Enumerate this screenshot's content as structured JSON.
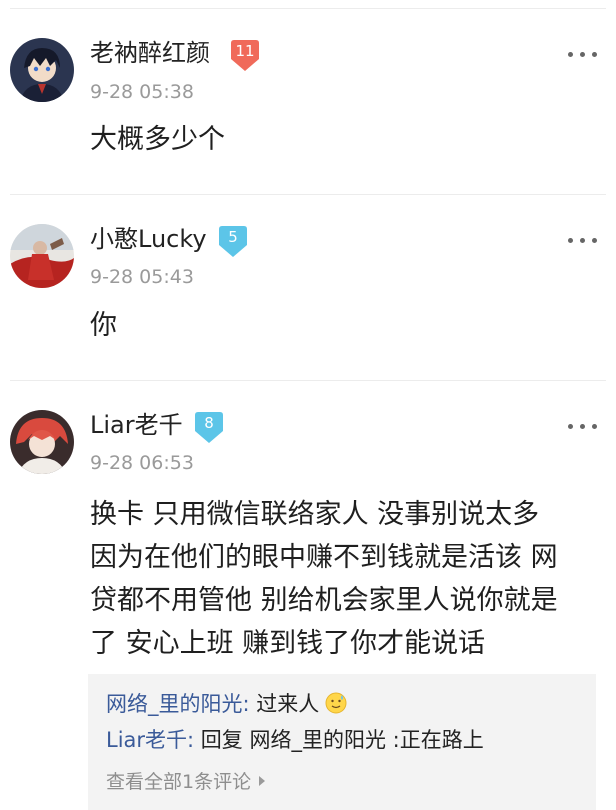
{
  "comments": [
    {
      "username": "老衲醉红颜",
      "level": "11",
      "level_color": "#f06a5a",
      "time": "9-28 05:38",
      "text": "大概多少个",
      "avatar_icon": "anime-boy-avatar"
    },
    {
      "username": "小憨Lucky",
      "level": "5",
      "level_color": "#5cc5e8",
      "time": "9-28 05:43",
      "text": "你",
      "avatar_icon": "person-in-red-avatar"
    },
    {
      "username": "Liar老千",
      "level": "8",
      "level_color": "#5cc5e8",
      "time": "9-28 06:53",
      "text_lines": [
        "换卡 只用微信联络家人 没事别说太多",
        "因为在他们的眼中赚不到钱就是活该 网",
        "贷都不用管他 别给机会家里人说你就是",
        "了 安心上班 赚到钱了你才能说话"
      ],
      "avatar_icon": "anime-red-hair-avatar",
      "replies": [
        {
          "author": "网络_里的阳光",
          "sep": ":",
          "text": " 过来人",
          "emoji": "sweat-smile-emoji"
        },
        {
          "author": "Liar老千",
          "sep": ":",
          "text": " 回复 网络_里的阳光 :正在路上"
        }
      ],
      "view_all_label": "查看全部1条评论"
    }
  ],
  "icons": {
    "more": "more-dots-icon",
    "caret": "caret-right-icon"
  }
}
